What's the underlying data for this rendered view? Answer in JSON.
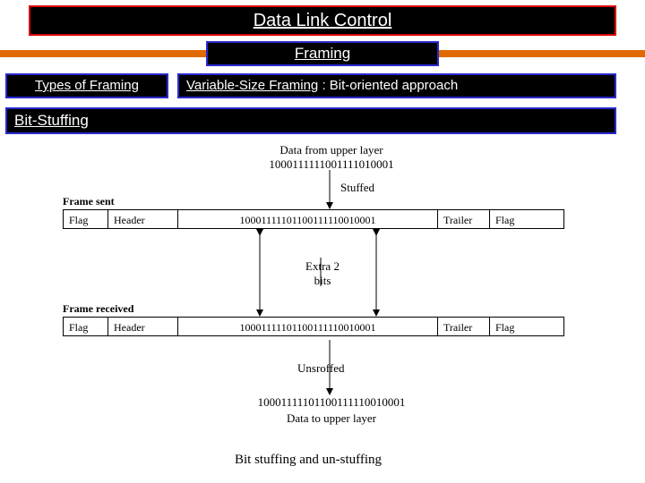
{
  "title": "Data Link Control",
  "subtitle": "Framing",
  "left_box": "Types of  Framing",
  "right_box_underlined": "Variable-Size Framing",
  "right_box_rest": " : Bit-oriented approach",
  "bitstuff_label": "Bit-Stuffing",
  "diagram": {
    "upper_label": "Data from upper layer",
    "upper_bits": "1000111111001111010001",
    "stuffed_label": "Stuffed",
    "frame_sent_label": "Frame sent",
    "frame_recv_label": "Frame received",
    "cols": {
      "flag": "Flag",
      "header": "Header",
      "trailer": "Trailer"
    },
    "sent_payload": "10001111101100111110010001",
    "recv_payload": "10001111101100111110010001",
    "extra_bits_label": "Extra 2\nbits",
    "unstuffed_label": "Unsroffed",
    "lower_bits": "10001111101100111110010001",
    "lower_label": "Data to upper layer"
  },
  "caption": "Bit stuffing and un-stuffing"
}
